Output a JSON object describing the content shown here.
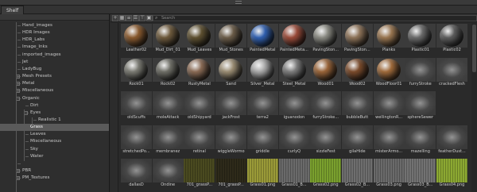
{
  "panel": {
    "title": "Shelf"
  },
  "toolbar": {
    "buttons": [
      {
        "name": "add-button",
        "glyph": "+"
      },
      {
        "name": "grid-view-button",
        "glyph": "▦"
      },
      {
        "name": "list-view-button",
        "glyph": "≡"
      },
      {
        "name": "details-view-button",
        "glyph": "☰"
      },
      {
        "name": "filter-button",
        "glyph": "⊤"
      },
      {
        "name": "settings-button",
        "glyph": "▣"
      }
    ],
    "search_placeholder": "Search"
  },
  "sidebar": {
    "items": [
      {
        "label": "Hand_images",
        "depth": 1,
        "expander": "",
        "selected": false
      },
      {
        "label": "HDR Images",
        "depth": 1,
        "expander": "",
        "selected": false
      },
      {
        "label": "HDR_Labs",
        "depth": 1,
        "expander": "",
        "selected": false
      },
      {
        "label": "Image_Inks",
        "depth": 1,
        "expander": "",
        "selected": false
      },
      {
        "label": "imported_images",
        "depth": 1,
        "expander": "",
        "selected": false
      },
      {
        "label": "Jet",
        "depth": 1,
        "expander": "",
        "selected": false
      },
      {
        "label": "LadyBug",
        "depth": 1,
        "expander": "",
        "selected": false
      },
      {
        "label": "Mesh Presets",
        "depth": 1,
        "expander": "+",
        "selected": false
      },
      {
        "label": "Metal",
        "depth": 1,
        "expander": "+",
        "selected": false
      },
      {
        "label": "Miscellaneous",
        "depth": 1,
        "expander": "+",
        "selected": false
      },
      {
        "label": "Organic",
        "depth": 1,
        "expander": "−",
        "selected": false
      },
      {
        "label": "Dirt",
        "depth": 2,
        "expander": "",
        "selected": false
      },
      {
        "label": "Eyes",
        "depth": 2,
        "expander": "−",
        "selected": false
      },
      {
        "label": "Realistic 1",
        "depth": 3,
        "expander": "",
        "selected": false
      },
      {
        "label": "Grass",
        "depth": 2,
        "expander": "",
        "selected": true
      },
      {
        "label": "Leaves",
        "depth": 2,
        "expander": "",
        "selected": false
      },
      {
        "label": "Miscellaneous",
        "depth": 2,
        "expander": "",
        "selected": false
      },
      {
        "label": "Sky",
        "depth": 2,
        "expander": "",
        "selected": false
      },
      {
        "label": "Water",
        "depth": 2,
        "expander": "",
        "selected": false
      },
      {
        "label": "",
        "depth": 1,
        "expander": "",
        "selected": false
      },
      {
        "label": "PBR",
        "depth": 1,
        "expander": "+",
        "selected": false
      },
      {
        "label": "PM_Textures",
        "depth": 1,
        "expander": "+",
        "selected": false
      }
    ]
  },
  "items": [
    {
      "label": "Leather02",
      "kind": "sphere",
      "color": "#8a5a2e"
    },
    {
      "label": "Mud_Dirt_01",
      "kind": "sphere",
      "color": "#6e5a3c"
    },
    {
      "label": "Mud_Leaves",
      "kind": "sphere",
      "color": "#5e5030"
    },
    {
      "label": "Mud_Stones",
      "kind": "sphere",
      "color": "#6b5c48"
    },
    {
      "label": "PaintedMetal",
      "kind": "sphere",
      "color": "#2f5fb0"
    },
    {
      "label": "PaintedMeta...",
      "kind": "sphere",
      "color": "#9a4a38"
    },
    {
      "label": "PavingSton...",
      "kind": "sphere",
      "color": "#8a8a82"
    },
    {
      "label": "PavingSton...",
      "kind": "sphere",
      "color": "#8e7358"
    },
    {
      "label": "Planks",
      "kind": "sphere",
      "color": "#9a7650"
    },
    {
      "label": "Plastic01",
      "kind": "sphere",
      "color": "#6a6a6a"
    },
    {
      "label": "Plastic02",
      "kind": "sphere",
      "color": "#5c5c5c"
    },
    {
      "label": "Rock01",
      "kind": "sphere",
      "color": "#7a7a72"
    },
    {
      "label": "Rock02",
      "kind": "sphere",
      "color": "#6e6e66"
    },
    {
      "label": "RustyMetal",
      "kind": "sphere",
      "color": "#8a6a54"
    },
    {
      "label": "Sand",
      "kind": "sphere",
      "color": "#9a8c72"
    },
    {
      "label": "Silver_Metal",
      "kind": "sphere",
      "color": "#a8a8a8"
    },
    {
      "label": "Steel_Metal",
      "kind": "sphere",
      "color": "#7c7c7c"
    },
    {
      "label": "Wood01",
      "kind": "sphere",
      "color": "#9a6438"
    },
    {
      "label": "Wood02",
      "kind": "sphere",
      "color": "#7a4a2a"
    },
    {
      "label": "WoodFloor01",
      "kind": "sphere",
      "color": "#a06a3a"
    },
    {
      "label": "furryStroke",
      "kind": "brush",
      "color": "#3a3a3a"
    },
    {
      "label": "crackedFlesh",
      "kind": "brush",
      "color": "#3e3e3e"
    },
    {
      "label": "oldScuffs",
      "kind": "brush",
      "color": "#3a3a3a"
    },
    {
      "label": "moleAttack",
      "kind": "brush",
      "color": "#3a3a3a"
    },
    {
      "label": "oldShipyard",
      "kind": "brush",
      "color": "#3a3a3a"
    },
    {
      "label": "jackFrost",
      "kind": "brush",
      "color": "#3a3a3a"
    },
    {
      "label": "terra2",
      "kind": "brush",
      "color": "#3a3a3a"
    },
    {
      "label": "iguanodon",
      "kind": "brush",
      "color": "#3a3a3a"
    },
    {
      "label": "furryStroke...",
      "kind": "brush",
      "color": "#3a3a3a"
    },
    {
      "label": "bubbleButt",
      "kind": "brush",
      "color": "#3a3a3a"
    },
    {
      "label": "wellingtonR...",
      "kind": "brush",
      "color": "#3a3a3a"
    },
    {
      "label": "sphereSewer",
      "kind": "brush",
      "color": "#3a3a3a"
    },
    {
      "label": "",
      "kind": "empty",
      "color": "#2a2a2a"
    },
    {
      "label": "stretchedPo...",
      "kind": "brush",
      "color": "#3a3a3a"
    },
    {
      "label": "membranez",
      "kind": "brush",
      "color": "#3a3a3a"
    },
    {
      "label": "retinal",
      "kind": "brush",
      "color": "#3a3a3a"
    },
    {
      "label": "wiggleWormo",
      "kind": "brush",
      "color": "#3a3a3a"
    },
    {
      "label": "griddle",
      "kind": "brush",
      "color": "#3a3a3a"
    },
    {
      "label": "curlyQ",
      "kind": "brush",
      "color": "#3a3a3a"
    },
    {
      "label": "sizzleFest",
      "kind": "brush",
      "color": "#3a3a3a"
    },
    {
      "label": "gilaHide",
      "kind": "brush",
      "color": "#3a3a3a"
    },
    {
      "label": "misterArmo...",
      "kind": "brush",
      "color": "#3a3a3a"
    },
    {
      "label": "mazelling",
      "kind": "brush",
      "color": "#3a3a3a"
    },
    {
      "label": "featherDust...",
      "kind": "brush",
      "color": "#3a3a3a"
    },
    {
      "label": "dallasD",
      "kind": "brush",
      "color": "#3a3a3a"
    },
    {
      "label": "Ondine",
      "kind": "brush",
      "color": "#3a3a3a"
    },
    {
      "label": "701_grassP...",
      "kind": "texture",
      "color": "#4a4a20"
    },
    {
      "label": "701_grassP...",
      "kind": "texture",
      "color": "#2e2a1a"
    },
    {
      "label": "Grass01.png",
      "kind": "texture",
      "color": "#9a9a38"
    },
    {
      "label": "Grass01_B...",
      "kind": "texture",
      "color": "#6a6a6a"
    },
    {
      "label": "Grass02.png",
      "kind": "texture",
      "color": "#7aa02e"
    },
    {
      "label": "Grass02_B...",
      "kind": "texture",
      "color": "#6e6e6e"
    },
    {
      "label": "Grass03.png",
      "kind": "texture",
      "color": "#6a6a6a"
    },
    {
      "label": "Grass03_B...",
      "kind": "texture",
      "color": "#727272"
    },
    {
      "label": "Grass04.png",
      "kind": "texture",
      "color": "#8ca832"
    }
  ]
}
